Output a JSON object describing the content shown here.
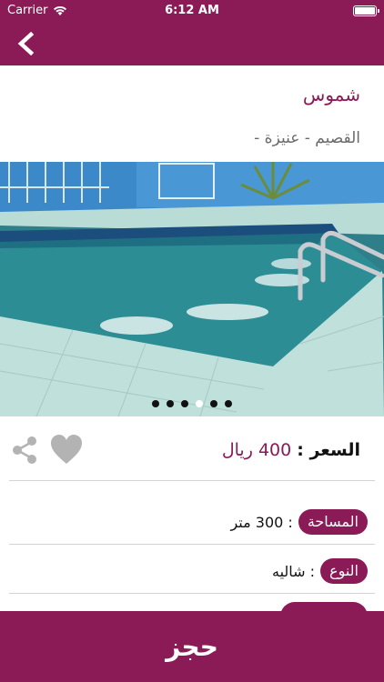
{
  "status_bar": {
    "carrier": "Carrier",
    "time": "6:12 AM"
  },
  "nav": {
    "back_icon": "chevron-left-icon"
  },
  "listing": {
    "title": "شموس",
    "location": "القصيم - عنيزة -"
  },
  "gallery": {
    "image": "swimming-pool-photo",
    "page_count": 6,
    "active_page": 5
  },
  "price": {
    "label": "السعر :",
    "value": "400 ريال"
  },
  "actions": {
    "share_icon": "share-icon",
    "favorite_icon": "heart-icon"
  },
  "attributes": [
    {
      "label": "المساحة",
      "value": ": 300 متر"
    },
    {
      "label": "النوع",
      "value": ": شاليه"
    }
  ],
  "book_button": {
    "label": "حجز"
  },
  "colors": {
    "brand": "#8a1b57",
    "dot_inactive": "#111111",
    "dot_active": "#ffffff"
  }
}
